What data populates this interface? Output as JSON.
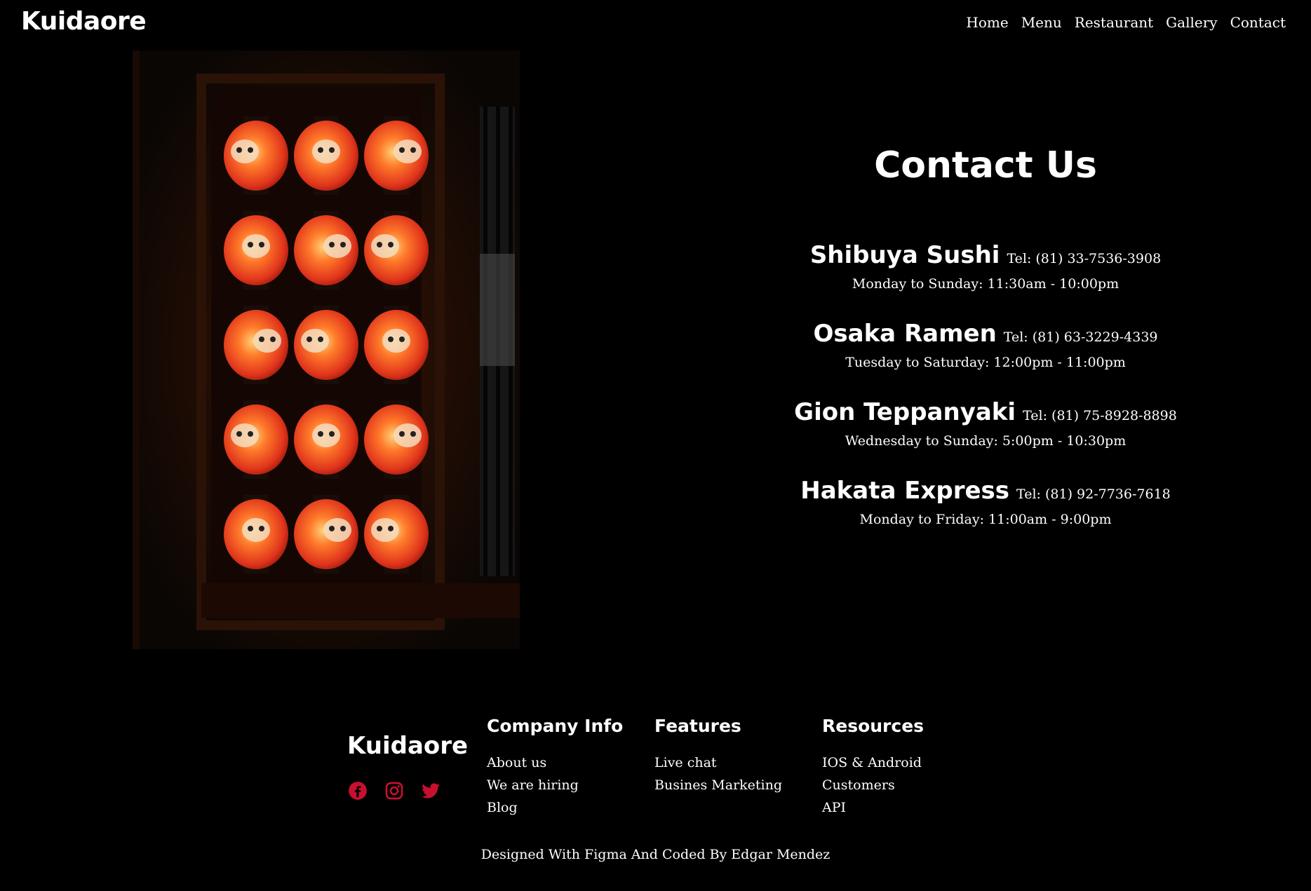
{
  "header": {
    "logo": "Kuidaore",
    "nav": [
      "Home",
      "Menu",
      "Restaurant",
      "Gallery",
      "Contact"
    ]
  },
  "hero_image": {
    "subject": "lanterns",
    "accent": "#e0341c"
  },
  "contact": {
    "title": "Contact Us",
    "locations": [
      {
        "name": "Shibuya Sushi",
        "tel": "Tel: (81) 33-7536-3908",
        "hours": "Monday to Sunday: 11:30am - 10:00pm"
      },
      {
        "name": "Osaka Ramen",
        "tel": "Tel: (81) 63-3229-4339",
        "hours": "Tuesday to Saturday: 12:00pm - 11:00pm"
      },
      {
        "name": "Gion Teppanyaki",
        "tel": "Tel: (81) 75-8928-8898",
        "hours": "Wednesday to Sunday: 5:00pm - 10:30pm"
      },
      {
        "name": "Hakata Express",
        "tel": "Tel: (81) 92-7736-7618",
        "hours": "Monday to Friday: 11:00am - 9:00pm"
      }
    ]
  },
  "footer": {
    "logo": "Kuidaore",
    "social_color": "#c8102e",
    "socials": [
      "facebook-icon",
      "instagram-icon",
      "twitter-icon"
    ],
    "columns": [
      {
        "title": "Company Info",
        "links": [
          "About us",
          "We are hiring",
          "Blog"
        ]
      },
      {
        "title": "Features",
        "links": [
          "Live chat",
          "Busines Marketing"
        ]
      },
      {
        "title": "Resources",
        "links": [
          "IOS & Android",
          "Customers",
          "API"
        ]
      }
    ],
    "credit": "Designed With Figma And Coded By Edgar Mendez"
  }
}
